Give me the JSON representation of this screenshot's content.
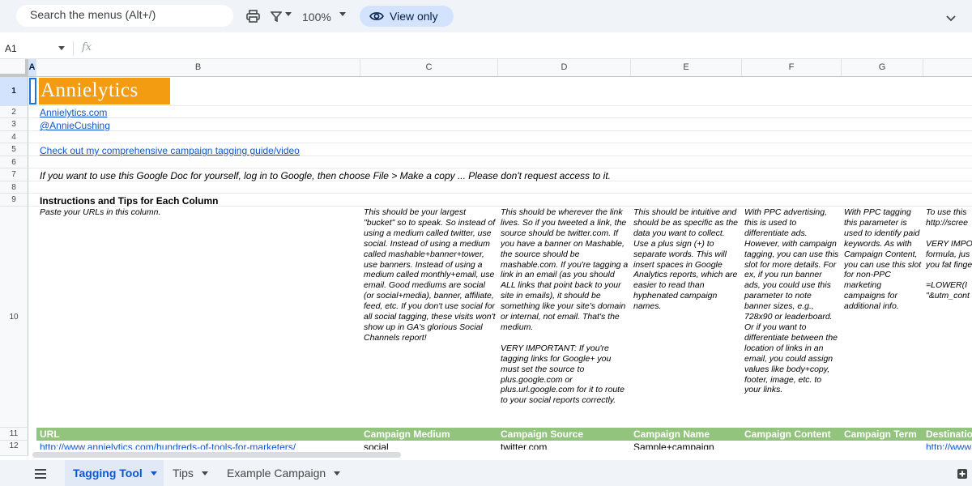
{
  "toolbar": {
    "search_placeholder": "Search the menus (Alt+/)",
    "zoom": "100%",
    "view_only": "View only"
  },
  "formula_bar": {
    "name_box": "A1",
    "fx": "fx"
  },
  "columns": [
    "A",
    "B",
    "C",
    "D",
    "E",
    "F",
    "G"
  ],
  "rows": [
    "1",
    "2",
    "3",
    "4",
    "5",
    "6",
    "7",
    "8",
    "9",
    "10",
    "11",
    "12"
  ],
  "content": {
    "logo": "Annielytics",
    "site_link": "Annielytics.com",
    "twitter_link": "@AnnieCushing",
    "guide_link": "Check out my comprehensive campaign tagging guide/video",
    "copy_note": "If you want to use this Google Doc for yourself, log in to Google, then choose File > Make a copy ... Please don't request access to it.",
    "instructions_heading": "Instructions and Tips for Each Column",
    "tip_b": "Paste your URLs in this column.",
    "tip_c": "This should be your largest \"bucket\" so to speak. So instead of using a medium called twitter, use social. Instead of using a medium called mashable+banner+tower, use banners. Instead of using a medium called monthly+email, use email. Good mediums are social (or social+media), banner, affiliate, feed, etc. If you don't use social for all social tagging, these visits won't show up in GA's glorious Social Channels report!",
    "tip_d": "This should be wherever the link lives. So if you tweeted a link, the source should be twitter.com. If you have a banner on Mashable, the source should be mashable.com. If you're tagging a link in an email (as you should ALL links that point back to your site in emails), it should be something like your site's domain or internal, not email. That's the medium.\n\nVERY IMPORTANT: If you're tagging links for Google+ you must set the source to plus.google.com or plus.url.google.com for it to route to your social reports correctly.",
    "tip_e": "This should be intuitive and should be as specific as the data you want to collect. Use a plus sign (+) to separate words. This will insert spaces in Google Analytics reports, which are easier to read than hyphenated campaign names.",
    "tip_f": "With PPC advertising, this is used to differentiate ads. However, with campaign tagging, you can use this slot for more details. For ex, if you run banner ads, you could use this parameter to note banner sizes, e.g., 728x90 or leaderboard. Or if you want to differentiate between the location of links in an email, you could assign values like body+copy, footer, image, etc. to your links.",
    "tip_g": "With PPC tagging this parameter is used to identify paid keywords. As with Campaign Content, you can use this slot for non-PPC marketing campaigns for additional info.",
    "tip_h": "To use this\nhttp://scree\n\nVERY IMPO\nformula, jus\nyou fat finge\n\n=LOWER(I\n\"&utm_cont"
  },
  "header_row": {
    "url": "URL",
    "medium": "Campaign Medium",
    "source": "Campaign Source",
    "name": "Campaign Name",
    "content": "Campaign Content",
    "term": "Campaign Term",
    "destination": "Destinatio"
  },
  "data_row": {
    "url": "http://www.annielytics.com/hundreds-of-tools-for-marketers/",
    "medium": "social",
    "source": "twitter.com",
    "name": "Sample+campaign",
    "destination": "http://www"
  },
  "sheets": [
    {
      "label": "Tagging Tool"
    },
    {
      "label": "Tips"
    },
    {
      "label": "Example Campaign"
    }
  ],
  "colors": {
    "accent": "#0b57d0",
    "logo_bg": "#f39c12",
    "header_green": "#93c47d"
  }
}
